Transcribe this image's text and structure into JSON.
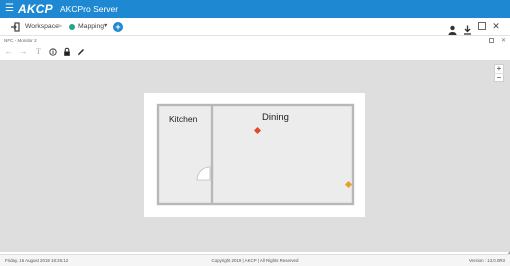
{
  "topbar": {
    "menu_icon": "hamburger-menu-icon",
    "logo": "AKCP",
    "title": "AKCPro Server",
    "color": "#1e88d2"
  },
  "breadcrumb": {
    "workspace": "Workspace",
    "separator": ">",
    "mapping": "Mapping",
    "mapping_dot_color": "#22a68a",
    "add_label": "+",
    "icons": [
      "exit-icon",
      "user-icon",
      "download-icon",
      "window-icon",
      "close-icon"
    ]
  },
  "map": {
    "name": "NFC - Monitor 2",
    "toolbar_icons": [
      "back-arrow-icon",
      "forward-arrow-icon",
      "text-icon",
      "info-icon",
      "lock-icon",
      "pencil-icon"
    ],
    "zoom_in_label": "+",
    "zoom_out_label": "−",
    "rooms": {
      "kitchen": "Kitchen",
      "dining": "Dining"
    },
    "sensors": [
      {
        "name": "sensor-red",
        "color": "#e04a2a"
      },
      {
        "name": "sensor-orange",
        "color": "#e8a030"
      }
    ]
  },
  "footer": {
    "date": "Friday, 16 August 2019 18:26:12",
    "copyright": "Copyright 2019 | AKCP | All Rights Reserved",
    "version": "Version : 13.0.0R3"
  }
}
